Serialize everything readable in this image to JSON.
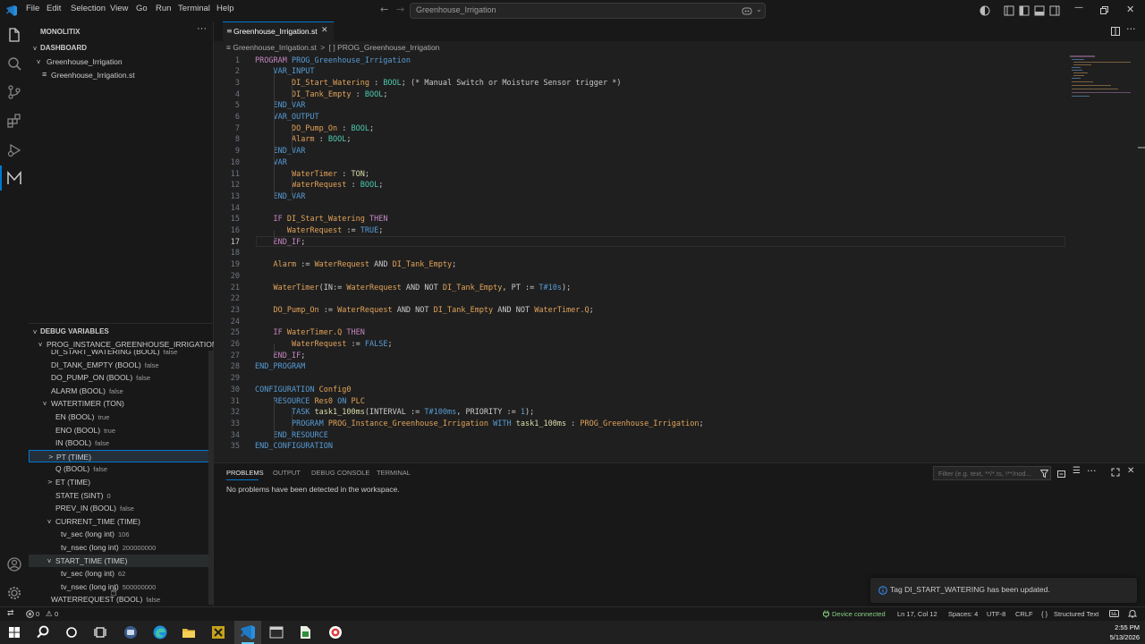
{
  "menu": [
    "File",
    "Edit",
    "Selection",
    "View",
    "Go",
    "Run",
    "Terminal",
    "Help"
  ],
  "command_center": "Greenhouse_Irrigation",
  "explorer": {
    "title": "MONOLITIX",
    "section": "DASHBOARD",
    "folder": "Greenhouse_Irrigation",
    "file": "Greenhouse_Irrigation.st"
  },
  "tab": {
    "label": "Greenhouse_Irrigation.st"
  },
  "breadcrumb": {
    "file": "Greenhouse_Irrigation.st",
    "sep": ">",
    "symbol": "PROG_Greenhouse_Irrigation"
  },
  "code_lines": [
    [
      [
        "kw",
        "PROGRAM"
      ],
      [
        "t",
        " "
      ],
      [
        "ds",
        "PROG_Greenhouse_Irrigation"
      ]
    ],
    [
      [
        "t",
        "    "
      ],
      [
        "ds",
        "VAR_INPUT"
      ]
    ],
    [
      [
        "t",
        "        "
      ],
      [
        "vr",
        "DI_Start_Watering"
      ],
      [
        "t",
        " : "
      ],
      [
        "ty",
        "BOOL"
      ],
      [
        "t",
        "; "
      ],
      [
        "cm",
        "(* Manual Switch or Moisture Sensor trigger *)"
      ]
    ],
    [
      [
        "t",
        "        "
      ],
      [
        "vr",
        "DI_Tank_Empty"
      ],
      [
        "t",
        " : "
      ],
      [
        "ty",
        "BOOL"
      ],
      [
        "t",
        ";"
      ]
    ],
    [
      [
        "t",
        "    "
      ],
      [
        "ds",
        "END_VAR"
      ]
    ],
    [
      [
        "t",
        "    "
      ],
      [
        "ds",
        "VAR_OUTPUT"
      ]
    ],
    [
      [
        "t",
        "        "
      ],
      [
        "vr",
        "DO_Pump_On"
      ],
      [
        "t",
        " : "
      ],
      [
        "ty",
        "BOOL"
      ],
      [
        "t",
        ";"
      ]
    ],
    [
      [
        "t",
        "        "
      ],
      [
        "vr",
        "Alarm"
      ],
      [
        "t",
        " : "
      ],
      [
        "ty",
        "BOOL"
      ],
      [
        "t",
        ";"
      ]
    ],
    [
      [
        "t",
        "    "
      ],
      [
        "ds",
        "END_VAR"
      ]
    ],
    [
      [
        "t",
        "    "
      ],
      [
        "ds",
        "VAR"
      ]
    ],
    [
      [
        "t",
        "        "
      ],
      [
        "vr",
        "WaterTimer"
      ],
      [
        "t",
        " : "
      ],
      [
        "fn",
        "TON"
      ],
      [
        "t",
        ";"
      ]
    ],
    [
      [
        "t",
        "        "
      ],
      [
        "vr",
        "WaterRequest"
      ],
      [
        "t",
        " : "
      ],
      [
        "ty",
        "BOOL"
      ],
      [
        "t",
        ";"
      ]
    ],
    [
      [
        "t",
        "    "
      ],
      [
        "ds",
        "END_VAR"
      ]
    ],
    [],
    [
      [
        "t",
        "    "
      ],
      [
        "kw",
        "IF"
      ],
      [
        "t",
        " "
      ],
      [
        "vr",
        "DI_Start_Watering"
      ],
      [
        "t",
        " "
      ],
      [
        "kw",
        "THEN"
      ]
    ],
    [
      [
        "t",
        "       "
      ],
      [
        "vr",
        "WaterRequest"
      ],
      [
        "t",
        " := "
      ],
      [
        "bl",
        "TRUE"
      ],
      [
        "t",
        ";"
      ]
    ],
    [
      [
        "t",
        "    "
      ],
      [
        "kw",
        "END_IF"
      ],
      [
        "t",
        ";"
      ]
    ],
    [],
    [
      [
        "t",
        "    "
      ],
      [
        "vr",
        "Alarm"
      ],
      [
        "t",
        " := "
      ],
      [
        "vr",
        "WaterRequest"
      ],
      [
        "t",
        " AND "
      ],
      [
        "vr",
        "DI_Tank_Empty"
      ],
      [
        "t",
        ";"
      ]
    ],
    [],
    [
      [
        "t",
        "    "
      ],
      [
        "vr",
        "WaterTimer"
      ],
      [
        "t",
        "(IN:= "
      ],
      [
        "vr",
        "WaterRequest"
      ],
      [
        "t",
        " AND NOT "
      ],
      [
        "vr",
        "DI_Tank_Empty"
      ],
      [
        "t",
        ", PT := "
      ],
      [
        "bl",
        "T#10s"
      ],
      [
        "t",
        ");"
      ]
    ],
    [],
    [
      [
        "t",
        "    "
      ],
      [
        "vr",
        "DO_Pump_On"
      ],
      [
        "t",
        " := "
      ],
      [
        "vr",
        "WaterRequest"
      ],
      [
        "t",
        " AND NOT "
      ],
      [
        "vr",
        "DI_Tank_Empty"
      ],
      [
        "t",
        " AND NOT "
      ],
      [
        "vr",
        "WaterTimer.Q"
      ],
      [
        "t",
        ";"
      ]
    ],
    [],
    [
      [
        "t",
        "    "
      ],
      [
        "kw",
        "IF"
      ],
      [
        "t",
        " "
      ],
      [
        "vr",
        "WaterTimer.Q"
      ],
      [
        "t",
        " "
      ],
      [
        "kw",
        "THEN"
      ]
    ],
    [
      [
        "t",
        "        "
      ],
      [
        "vr",
        "WaterRequest"
      ],
      [
        "t",
        " := "
      ],
      [
        "bl",
        "FALSE"
      ],
      [
        "t",
        ";"
      ]
    ],
    [
      [
        "t",
        "    "
      ],
      [
        "kw",
        "END_IF"
      ],
      [
        "t",
        ";"
      ]
    ],
    [
      [
        "ds",
        "END_PROGRAM"
      ]
    ],
    [],
    [
      [
        "ds",
        "CONFIGURATION"
      ],
      [
        "t",
        " "
      ],
      [
        "vr",
        "Config0"
      ]
    ],
    [
      [
        "t",
        "    "
      ],
      [
        "ds",
        "RESOURCE"
      ],
      [
        "t",
        " "
      ],
      [
        "vr",
        "Res0"
      ],
      [
        "t",
        " "
      ],
      [
        "ds",
        "ON"
      ],
      [
        "t",
        " "
      ],
      [
        "vr",
        "PLC"
      ]
    ],
    [
      [
        "t",
        "        "
      ],
      [
        "ds",
        "TASK"
      ],
      [
        "t",
        " "
      ],
      [
        "fn",
        "task1_100ms"
      ],
      [
        "t",
        "(INTERVAL := "
      ],
      [
        "bl",
        "T#100ms"
      ],
      [
        "t",
        ", PRIORITY := "
      ],
      [
        "bl",
        "1"
      ],
      [
        "t",
        ");"
      ]
    ],
    [
      [
        "t",
        "        "
      ],
      [
        "ds",
        "PROGRAM"
      ],
      [
        "t",
        " "
      ],
      [
        "vr",
        "PROG_Instance_Greenhouse_Irrigation"
      ],
      [
        "t",
        " "
      ],
      [
        "ds",
        "WITH"
      ],
      [
        "t",
        " "
      ],
      [
        "fn",
        "task1_100ms"
      ],
      [
        "t",
        " : "
      ],
      [
        "vr",
        "PROG_Greenhouse_Irrigation"
      ],
      [
        "t",
        ";"
      ]
    ],
    [
      [
        "t",
        "    "
      ],
      [
        "ds",
        "END_RESOURCE"
      ]
    ],
    [
      [
        "ds",
        "END_CONFIGURATION"
      ]
    ]
  ],
  "debug": {
    "title": "DEBUG VARIABLES",
    "instance": "PROG_INSTANCE_GREENHOUSE_IRRIGATION...",
    "rows": [
      {
        "label": "DI_START_WATERING (BOOL)",
        "value": "false",
        "indent": 0,
        "chev": ""
      },
      {
        "label": "DI_TANK_EMPTY (BOOL)",
        "value": "false",
        "indent": 0,
        "chev": ""
      },
      {
        "label": "DO_PUMP_ON (BOOL)",
        "value": "false",
        "indent": 0,
        "chev": ""
      },
      {
        "label": "ALARM (BOOL)",
        "value": "false",
        "indent": 0,
        "chev": ""
      },
      {
        "label": "WATERTIMER (TON)",
        "value": "",
        "indent": 0,
        "chev": "v"
      },
      {
        "label": "EN (BOOL)",
        "value": "true",
        "indent": 1,
        "chev": ""
      },
      {
        "label": "ENO (BOOL)",
        "value": "true",
        "indent": 1,
        "chev": ""
      },
      {
        "label": "IN (BOOL)",
        "value": "false",
        "indent": 1,
        "chev": ""
      },
      {
        "label": "PT (TIME)",
        "value": "",
        "indent": 1,
        "chev": ">"
      },
      {
        "label": "Q (BOOL)",
        "value": "false",
        "indent": 1,
        "chev": ""
      },
      {
        "label": "ET (TIME)",
        "value": "",
        "indent": 1,
        "chev": ">"
      },
      {
        "label": "STATE (SINT)",
        "value": "0",
        "indent": 1,
        "chev": ""
      },
      {
        "label": "PREV_IN (BOOL)",
        "value": "false",
        "indent": 1,
        "chev": ""
      },
      {
        "label": "CURRENT_TIME (TIME)",
        "value": "",
        "indent": 1,
        "chev": "v"
      },
      {
        "label": "tv_sec (long int)",
        "value": "106",
        "indent": 2,
        "chev": ""
      },
      {
        "label": "tv_nsec (long int)",
        "value": "200000000",
        "indent": 2,
        "chev": ""
      },
      {
        "label": "START_TIME (TIME)",
        "value": "",
        "indent": 1,
        "chev": "v"
      },
      {
        "label": "tv_sec (long int)",
        "value": "62",
        "indent": 2,
        "chev": ""
      },
      {
        "label": "tv_nsec (long int)",
        "value": "500000000",
        "indent": 2,
        "chev": ""
      },
      {
        "label": "WATERREQUEST (BOOL)",
        "value": "false",
        "indent": 0,
        "chev": ""
      }
    ]
  },
  "panel": {
    "tabs": [
      "PROBLEMS",
      "OUTPUT",
      "DEBUG CONSOLE",
      "TERMINAL"
    ],
    "active_tab": "PROBLEMS",
    "filter_placeholder": "Filter (e.g. text, **/*.ts, !**/nod...",
    "message": "No problems have been detected in the workspace."
  },
  "notification": "Tag DI_START_WATERING has been updated.",
  "statusbar": {
    "errors": "0",
    "warnings": "0",
    "device": "Device connected",
    "position": "Ln 17, Col 12",
    "spaces": "Spaces: 4",
    "encoding": "UTF-8",
    "eol": "CRLF",
    "language": "Structured Text"
  },
  "taskbar": {
    "time": "2:55 PM",
    "date": "5/13/2026"
  },
  "colors": {
    "accent": "#0078d4",
    "device_green": "#89d185",
    "info_blue": "#3794ff"
  }
}
